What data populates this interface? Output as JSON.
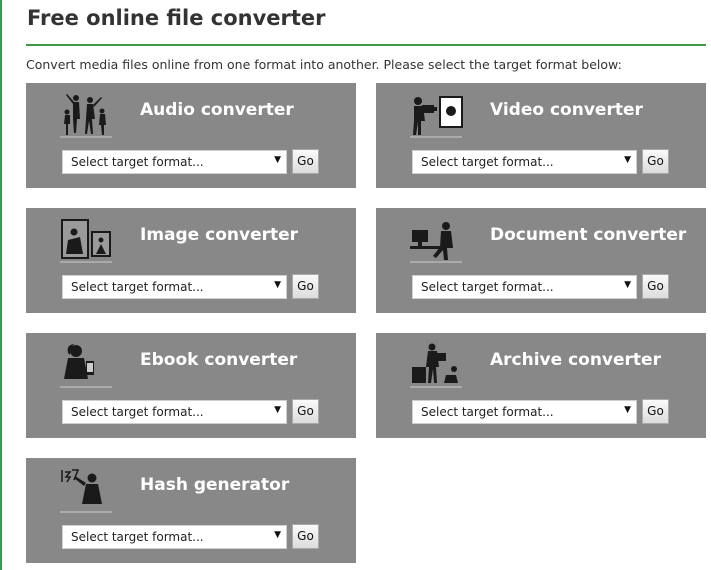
{
  "page": {
    "title": "Free online file converter",
    "intro": "Convert media files online from one format into another. Please select the target format below:"
  },
  "colors": {
    "accent": "#3a9a4a",
    "card_background": "#888888",
    "card_title": "#ffffff"
  },
  "converters": [
    {
      "title": "Audio converter",
      "icon": "dancers-icon",
      "select_placeholder": "Select target format...",
      "go_label": "Go"
    },
    {
      "title": "Video converter",
      "icon": "video-camera-icon",
      "select_placeholder": "Select target format...",
      "go_label": "Go"
    },
    {
      "title": "Image converter",
      "icon": "picture-frames-icon",
      "select_placeholder": "Select target format...",
      "go_label": "Go"
    },
    {
      "title": "Document converter",
      "icon": "desk-computer-icon",
      "select_placeholder": "Select target format...",
      "go_label": "Go"
    },
    {
      "title": "Ebook converter",
      "icon": "ebook-reader-icon",
      "select_placeholder": "Select target format...",
      "go_label": "Go"
    },
    {
      "title": "Archive converter",
      "icon": "archive-box-icon",
      "select_placeholder": "Select target format...",
      "go_label": "Go"
    },
    {
      "title": "Hash generator",
      "icon": "hash-writer-icon",
      "select_placeholder": "Select target format...",
      "go_label": "Go"
    }
  ]
}
